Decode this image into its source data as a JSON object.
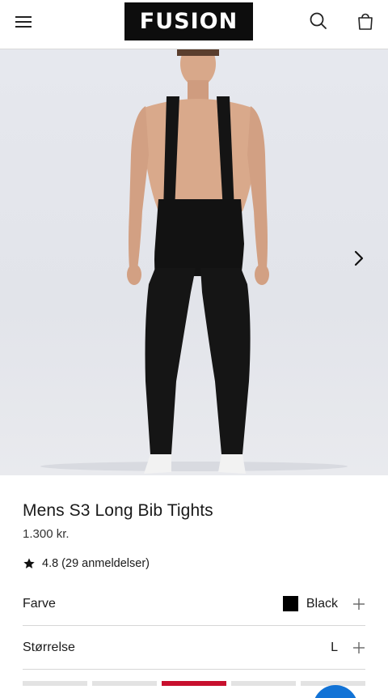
{
  "header": {
    "logo_text": "FUSION",
    "menu_icon": "hamburger-menu-icon",
    "search_icon": "search-icon",
    "cart_icon": "shopping-bag-icon"
  },
  "gallery": {
    "image_alt": "Model wearing black long bib tights",
    "next_icon": "chevron-right-icon",
    "slide_count": 5,
    "active_slide_index": 2
  },
  "product": {
    "title": "Mens S3 Long Bib Tights",
    "price": "1.300 kr.",
    "rating": "4.8 (29 anmeldelser)"
  },
  "options": {
    "color": {
      "label": "Farve",
      "value": "Black",
      "swatch_color": "#000000"
    },
    "size": {
      "label": "Størrelse",
      "value": "L"
    }
  },
  "colors": {
    "accent": "#c8102e",
    "chat_button": "#1273d6"
  }
}
